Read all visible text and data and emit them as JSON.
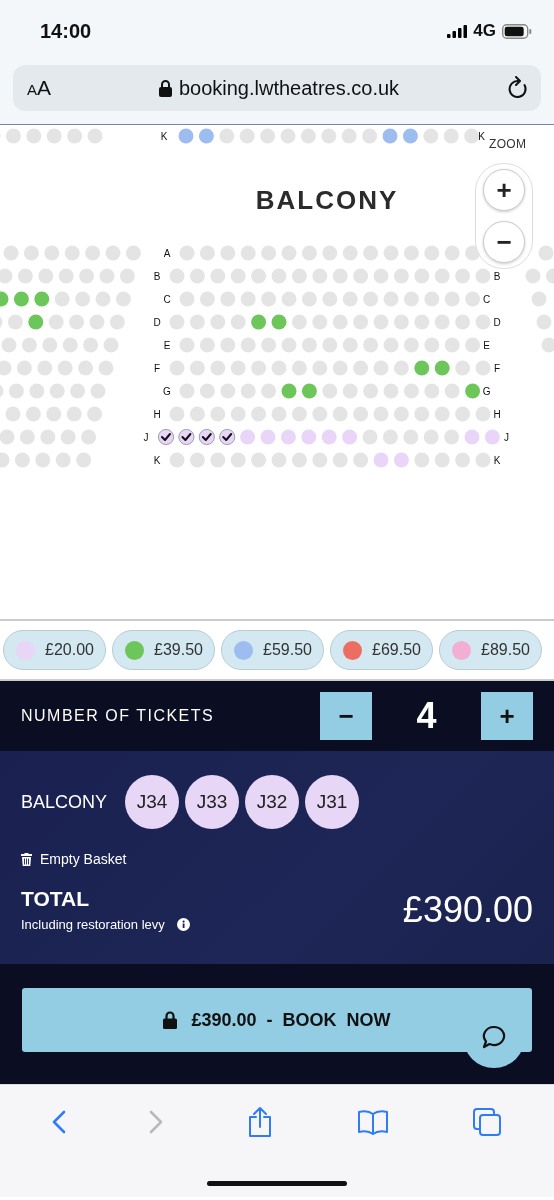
{
  "status_bar": {
    "time": "14:00",
    "network": "4G"
  },
  "address_bar": {
    "text_size": "AA",
    "url": "booking.lwtheatres.co.uk"
  },
  "seat_map": {
    "previous_row": {
      "label_left": "K",
      "label_right": "K",
      "left": [
        {
          "kind": "sold"
        },
        {
          "kind": "sold"
        },
        {
          "kind": "sold"
        },
        {
          "kind": "sold"
        },
        {
          "kind": "sold"
        },
        {
          "kind": "sold"
        }
      ],
      "center": [
        {
          "kind": "available",
          "color": "#9dbcef"
        },
        {
          "kind": "available",
          "color": "#9dbcef"
        },
        {
          "kind": "sold"
        },
        {
          "kind": "sold"
        },
        {
          "kind": "sold"
        },
        {
          "kind": "sold"
        },
        {
          "kind": "sold"
        },
        {
          "kind": "sold"
        },
        {
          "kind": "sold"
        },
        {
          "kind": "sold"
        },
        {
          "kind": "available",
          "color": "#9dbcef"
        },
        {
          "kind": "available",
          "color": "#9dbcef"
        },
        {
          "kind": "sold"
        },
        {
          "kind": "sold"
        },
        {
          "kind": "sold"
        }
      ]
    },
    "section_title": "BALCONY",
    "zoom": {
      "label": "ZOOM",
      "zoom_in": "+",
      "zoom_out": "−"
    },
    "rows": [
      {
        "label_left": "A",
        "left": [
          {
            "kind": "sold"
          },
          {
            "kind": "sold"
          },
          {
            "kind": "sold"
          },
          {
            "kind": "sold"
          },
          {
            "kind": "sold"
          },
          {
            "kind": "sold"
          },
          {
            "kind": "sold"
          }
        ],
        "center": [
          {
            "kind": "sold"
          },
          {
            "kind": "sold"
          },
          {
            "kind": "sold"
          },
          {
            "kind": "sold"
          },
          {
            "kind": "sold"
          },
          {
            "kind": "sold"
          },
          {
            "kind": "sold"
          },
          {
            "kind": "sold"
          },
          {
            "kind": "sold"
          },
          {
            "kind": "sold"
          },
          {
            "kind": "sold"
          },
          {
            "kind": "sold"
          },
          {
            "kind": "sold"
          },
          {
            "kind": "sold"
          },
          {
            "kind": "sold"
          }
        ],
        "right": [
          {
            "kind": "sold"
          }
        ]
      },
      {
        "label_left": "B",
        "label_right": "B",
        "left": [
          {
            "kind": "sold"
          },
          {
            "kind": "sold"
          },
          {
            "kind": "sold"
          },
          {
            "kind": "sold"
          },
          {
            "kind": "sold"
          },
          {
            "kind": "sold"
          },
          {
            "kind": "sold"
          }
        ],
        "center": [
          {
            "kind": "sold"
          },
          {
            "kind": "sold"
          },
          {
            "kind": "sold"
          },
          {
            "kind": "sold"
          },
          {
            "kind": "sold"
          },
          {
            "kind": "sold"
          },
          {
            "kind": "sold"
          },
          {
            "kind": "sold"
          },
          {
            "kind": "sold"
          },
          {
            "kind": "sold"
          },
          {
            "kind": "sold"
          },
          {
            "kind": "sold"
          },
          {
            "kind": "sold"
          },
          {
            "kind": "sold"
          },
          {
            "kind": "sold"
          },
          {
            "kind": "sold"
          }
        ],
        "right": [
          {
            "kind": "sold"
          },
          {
            "kind": "sold"
          }
        ]
      },
      {
        "label_left": "C",
        "label_right": "C",
        "left": [
          {
            "kind": "available",
            "color": "#6cc65a"
          },
          {
            "kind": "available",
            "color": "#6cc65a"
          },
          {
            "kind": "available",
            "color": "#6cc65a"
          },
          {
            "kind": "sold"
          },
          {
            "kind": "sold"
          },
          {
            "kind": "sold"
          },
          {
            "kind": "sold"
          }
        ],
        "center": [
          {
            "kind": "sold"
          },
          {
            "kind": "sold"
          },
          {
            "kind": "sold"
          },
          {
            "kind": "sold"
          },
          {
            "kind": "sold"
          },
          {
            "kind": "sold"
          },
          {
            "kind": "sold"
          },
          {
            "kind": "sold"
          },
          {
            "kind": "sold"
          },
          {
            "kind": "sold"
          },
          {
            "kind": "sold"
          },
          {
            "kind": "sold"
          },
          {
            "kind": "sold"
          },
          {
            "kind": "sold"
          },
          {
            "kind": "sold"
          }
        ],
        "right": [
          {
            "kind": "sold"
          }
        ]
      },
      {
        "label_left": "D",
        "label_right": "D",
        "left": [
          {
            "kind": "sold"
          },
          {
            "kind": "sold"
          },
          {
            "kind": "available",
            "color": "#6cc65a"
          },
          {
            "kind": "sold"
          },
          {
            "kind": "sold"
          },
          {
            "kind": "sold"
          },
          {
            "kind": "sold"
          }
        ],
        "center": [
          {
            "kind": "sold"
          },
          {
            "kind": "sold"
          },
          {
            "kind": "sold"
          },
          {
            "kind": "sold"
          },
          {
            "kind": "available",
            "color": "#6cc65a"
          },
          {
            "kind": "available",
            "color": "#6cc65a"
          },
          {
            "kind": "sold"
          },
          {
            "kind": "sold"
          },
          {
            "kind": "sold"
          },
          {
            "kind": "sold"
          },
          {
            "kind": "sold"
          },
          {
            "kind": "sold"
          },
          {
            "kind": "sold"
          },
          {
            "kind": "sold"
          },
          {
            "kind": "sold"
          },
          {
            "kind": "sold"
          }
        ],
        "right": [
          {
            "kind": "sold"
          }
        ]
      },
      {
        "label_left": "E",
        "label_right": "E",
        "left": [
          {
            "kind": "sold"
          },
          {
            "kind": "sold"
          },
          {
            "kind": "sold"
          },
          {
            "kind": "sold"
          },
          {
            "kind": "sold"
          },
          {
            "kind": "sold"
          }
        ],
        "center": [
          {
            "kind": "sold"
          },
          {
            "kind": "sold"
          },
          {
            "kind": "sold"
          },
          {
            "kind": "sold"
          },
          {
            "kind": "sold"
          },
          {
            "kind": "sold"
          },
          {
            "kind": "sold"
          },
          {
            "kind": "sold"
          },
          {
            "kind": "sold"
          },
          {
            "kind": "sold"
          },
          {
            "kind": "sold"
          },
          {
            "kind": "sold"
          },
          {
            "kind": "sold"
          },
          {
            "kind": "sold"
          },
          {
            "kind": "sold"
          }
        ],
        "right": [
          {
            "kind": "sold"
          }
        ]
      },
      {
        "label_left": "F",
        "label_right": "F",
        "left": [
          {
            "kind": "sold"
          },
          {
            "kind": "sold"
          },
          {
            "kind": "sold"
          },
          {
            "kind": "sold"
          },
          {
            "kind": "sold"
          },
          {
            "kind": "sold"
          }
        ],
        "center": [
          {
            "kind": "sold"
          },
          {
            "kind": "sold"
          },
          {
            "kind": "sold"
          },
          {
            "kind": "sold"
          },
          {
            "kind": "sold"
          },
          {
            "kind": "sold"
          },
          {
            "kind": "sold"
          },
          {
            "kind": "sold"
          },
          {
            "kind": "sold"
          },
          {
            "kind": "sold"
          },
          {
            "kind": "sold"
          },
          {
            "kind": "sold"
          },
          {
            "kind": "available",
            "color": "#6cc65a"
          },
          {
            "kind": "available",
            "color": "#6cc65a"
          },
          {
            "kind": "sold"
          },
          {
            "kind": "sold"
          }
        ]
      },
      {
        "label_left": "G",
        "label_right": "G",
        "left": [
          {
            "kind": "sold"
          },
          {
            "kind": "sold"
          },
          {
            "kind": "sold"
          },
          {
            "kind": "sold"
          },
          {
            "kind": "sold"
          },
          {
            "kind": "sold"
          }
        ],
        "center": [
          {
            "kind": "sold"
          },
          {
            "kind": "sold"
          },
          {
            "kind": "sold"
          },
          {
            "kind": "sold"
          },
          {
            "kind": "sold"
          },
          {
            "kind": "available",
            "color": "#6cc65a"
          },
          {
            "kind": "available",
            "color": "#6cc65a"
          },
          {
            "kind": "sold"
          },
          {
            "kind": "sold"
          },
          {
            "kind": "sold"
          },
          {
            "kind": "sold"
          },
          {
            "kind": "sold"
          },
          {
            "kind": "sold"
          },
          {
            "kind": "sold"
          },
          {
            "kind": "available",
            "color": "#6cc65a"
          }
        ]
      },
      {
        "label_left": "H",
        "label_right": "H",
        "left": [
          {
            "kind": "sold"
          },
          {
            "kind": "sold"
          },
          {
            "kind": "sold"
          },
          {
            "kind": "sold"
          },
          {
            "kind": "sold"
          }
        ],
        "center": [
          {
            "kind": "sold"
          },
          {
            "kind": "sold"
          },
          {
            "kind": "sold"
          },
          {
            "kind": "sold"
          },
          {
            "kind": "sold"
          },
          {
            "kind": "sold"
          },
          {
            "kind": "sold"
          },
          {
            "kind": "sold"
          },
          {
            "kind": "sold"
          },
          {
            "kind": "sold"
          },
          {
            "kind": "sold"
          },
          {
            "kind": "sold"
          },
          {
            "kind": "sold"
          },
          {
            "kind": "sold"
          },
          {
            "kind": "sold"
          },
          {
            "kind": "sold"
          }
        ]
      },
      {
        "label_left": "J",
        "label_right": "J",
        "left": [
          {
            "kind": "sold"
          },
          {
            "kind": "sold"
          },
          {
            "kind": "sold"
          },
          {
            "kind": "sold"
          },
          {
            "kind": "sold"
          }
        ],
        "center": [
          {
            "kind": "selected",
            "color": "#e8d5f8"
          },
          {
            "kind": "selected",
            "color": "#e8d5f8"
          },
          {
            "kind": "selected",
            "color": "#e8d5f8"
          },
          {
            "kind": "selected",
            "color": "#e8d5f8"
          },
          {
            "kind": "available",
            "color": "#e8d5f8"
          },
          {
            "kind": "available",
            "color": "#e8d5f8"
          },
          {
            "kind": "available",
            "color": "#e8d5f8"
          },
          {
            "kind": "available",
            "color": "#e8d5f8"
          },
          {
            "kind": "available",
            "color": "#e8d5f8"
          },
          {
            "kind": "available",
            "color": "#e8d5f8"
          },
          {
            "kind": "sold"
          },
          {
            "kind": "sold"
          },
          {
            "kind": "sold"
          },
          {
            "kind": "sold"
          },
          {
            "kind": "sold"
          },
          {
            "kind": "available",
            "color": "#e8d5f8"
          },
          {
            "kind": "available",
            "color": "#e8d5f8"
          }
        ]
      },
      {
        "label_left": "K",
        "label_right": "K",
        "left": [
          {
            "kind": "sold"
          },
          {
            "kind": "sold"
          },
          {
            "kind": "sold"
          },
          {
            "kind": "sold"
          },
          {
            "kind": "sold"
          }
        ],
        "center": [
          {
            "kind": "sold"
          },
          {
            "kind": "sold"
          },
          {
            "kind": "sold"
          },
          {
            "kind": "sold"
          },
          {
            "kind": "sold"
          },
          {
            "kind": "sold"
          },
          {
            "kind": "sold"
          },
          {
            "kind": "sold"
          },
          {
            "kind": "sold"
          },
          {
            "kind": "sold"
          },
          {
            "kind": "available",
            "color": "#e8d5f8"
          },
          {
            "kind": "available",
            "color": "#e8d5f8"
          },
          {
            "kind": "sold"
          },
          {
            "kind": "sold"
          },
          {
            "kind": "sold"
          },
          {
            "kind": "sold"
          }
        ]
      }
    ]
  },
  "price_bands": [
    {
      "price": "£20.00",
      "color": "#e8d5f8"
    },
    {
      "price": "£39.50",
      "color": "#6cc65a"
    },
    {
      "price": "£59.50",
      "color": "#9dbcef"
    },
    {
      "price": "£69.50",
      "color": "#ec6e62"
    },
    {
      "price": "£89.50",
      "color": "#f2aed3"
    }
  ],
  "tickets": {
    "label": "NUMBER OF TICKETS",
    "decrease": "−",
    "count": "4",
    "increase": "+"
  },
  "basket": {
    "section": "BALCONY",
    "seats": [
      "J34",
      "J33",
      "J32",
      "J31"
    ],
    "empty_basket": "Empty Basket",
    "total_label": "TOTAL",
    "total_note": "Including restoration levy",
    "total": "£390.00"
  },
  "book": {
    "label": "£390.00 - BOOK NOW"
  },
  "toolbar": {
    "back_disabled": false,
    "forward_disabled": true
  }
}
